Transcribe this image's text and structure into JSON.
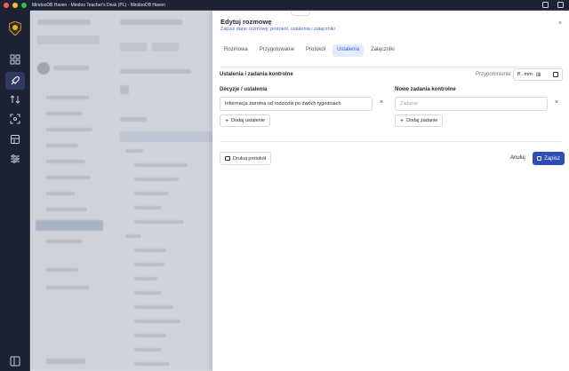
{
  "window": {
    "title": "MindooDB Haven - Mindoo Teacher's Desk (PL) - MindooDB Haven"
  },
  "colors": {
    "accent": "#2f4db8",
    "rail_bg": "#1c2133",
    "active_tab_bg": "#e4ecfb"
  },
  "rail": {
    "icons": [
      "app-logo-icon",
      "dashboard-icon",
      "rocket-icon",
      "sort-arrows-icon",
      "scan-icon",
      "database-icon",
      "sliders-icon",
      "sidebar-toggle-icon"
    ]
  },
  "dialog": {
    "title": "Edytuj rozmowę",
    "subtitle": "Zapisz dane rozmowy, protokół, ustalenia i załączniki",
    "close_label": "×",
    "tabs": [
      {
        "label": "Rozmowa",
        "active": false
      },
      {
        "label": "Przygotowanie",
        "active": false
      },
      {
        "label": "Protokół",
        "active": false
      },
      {
        "label": "Ustalenia",
        "active": true
      },
      {
        "label": "Załączniki",
        "active": false
      }
    ],
    "section_title": "Ustalenia i zadania kontrolne",
    "reminder": {
      "label": "Przypomnienie",
      "value": "ff . mm . jjjj"
    },
    "decisions": {
      "label": "Decyzje / ustalenia",
      "items": [
        "Informacja zwrotna od rodziców po dwóch tygodniach"
      ],
      "remove_label": "×",
      "add_label": "Dodaj ustalenie"
    },
    "tasks": {
      "label": "Nowe zadania kontrolne",
      "placeholder": "Zadanie",
      "remove_label": "×",
      "add_label": "Dodaj zadanie"
    },
    "footer": {
      "print_label": "Drukuj protokół",
      "cancel_label": "Anuluj",
      "save_label": "Zapisz"
    }
  }
}
